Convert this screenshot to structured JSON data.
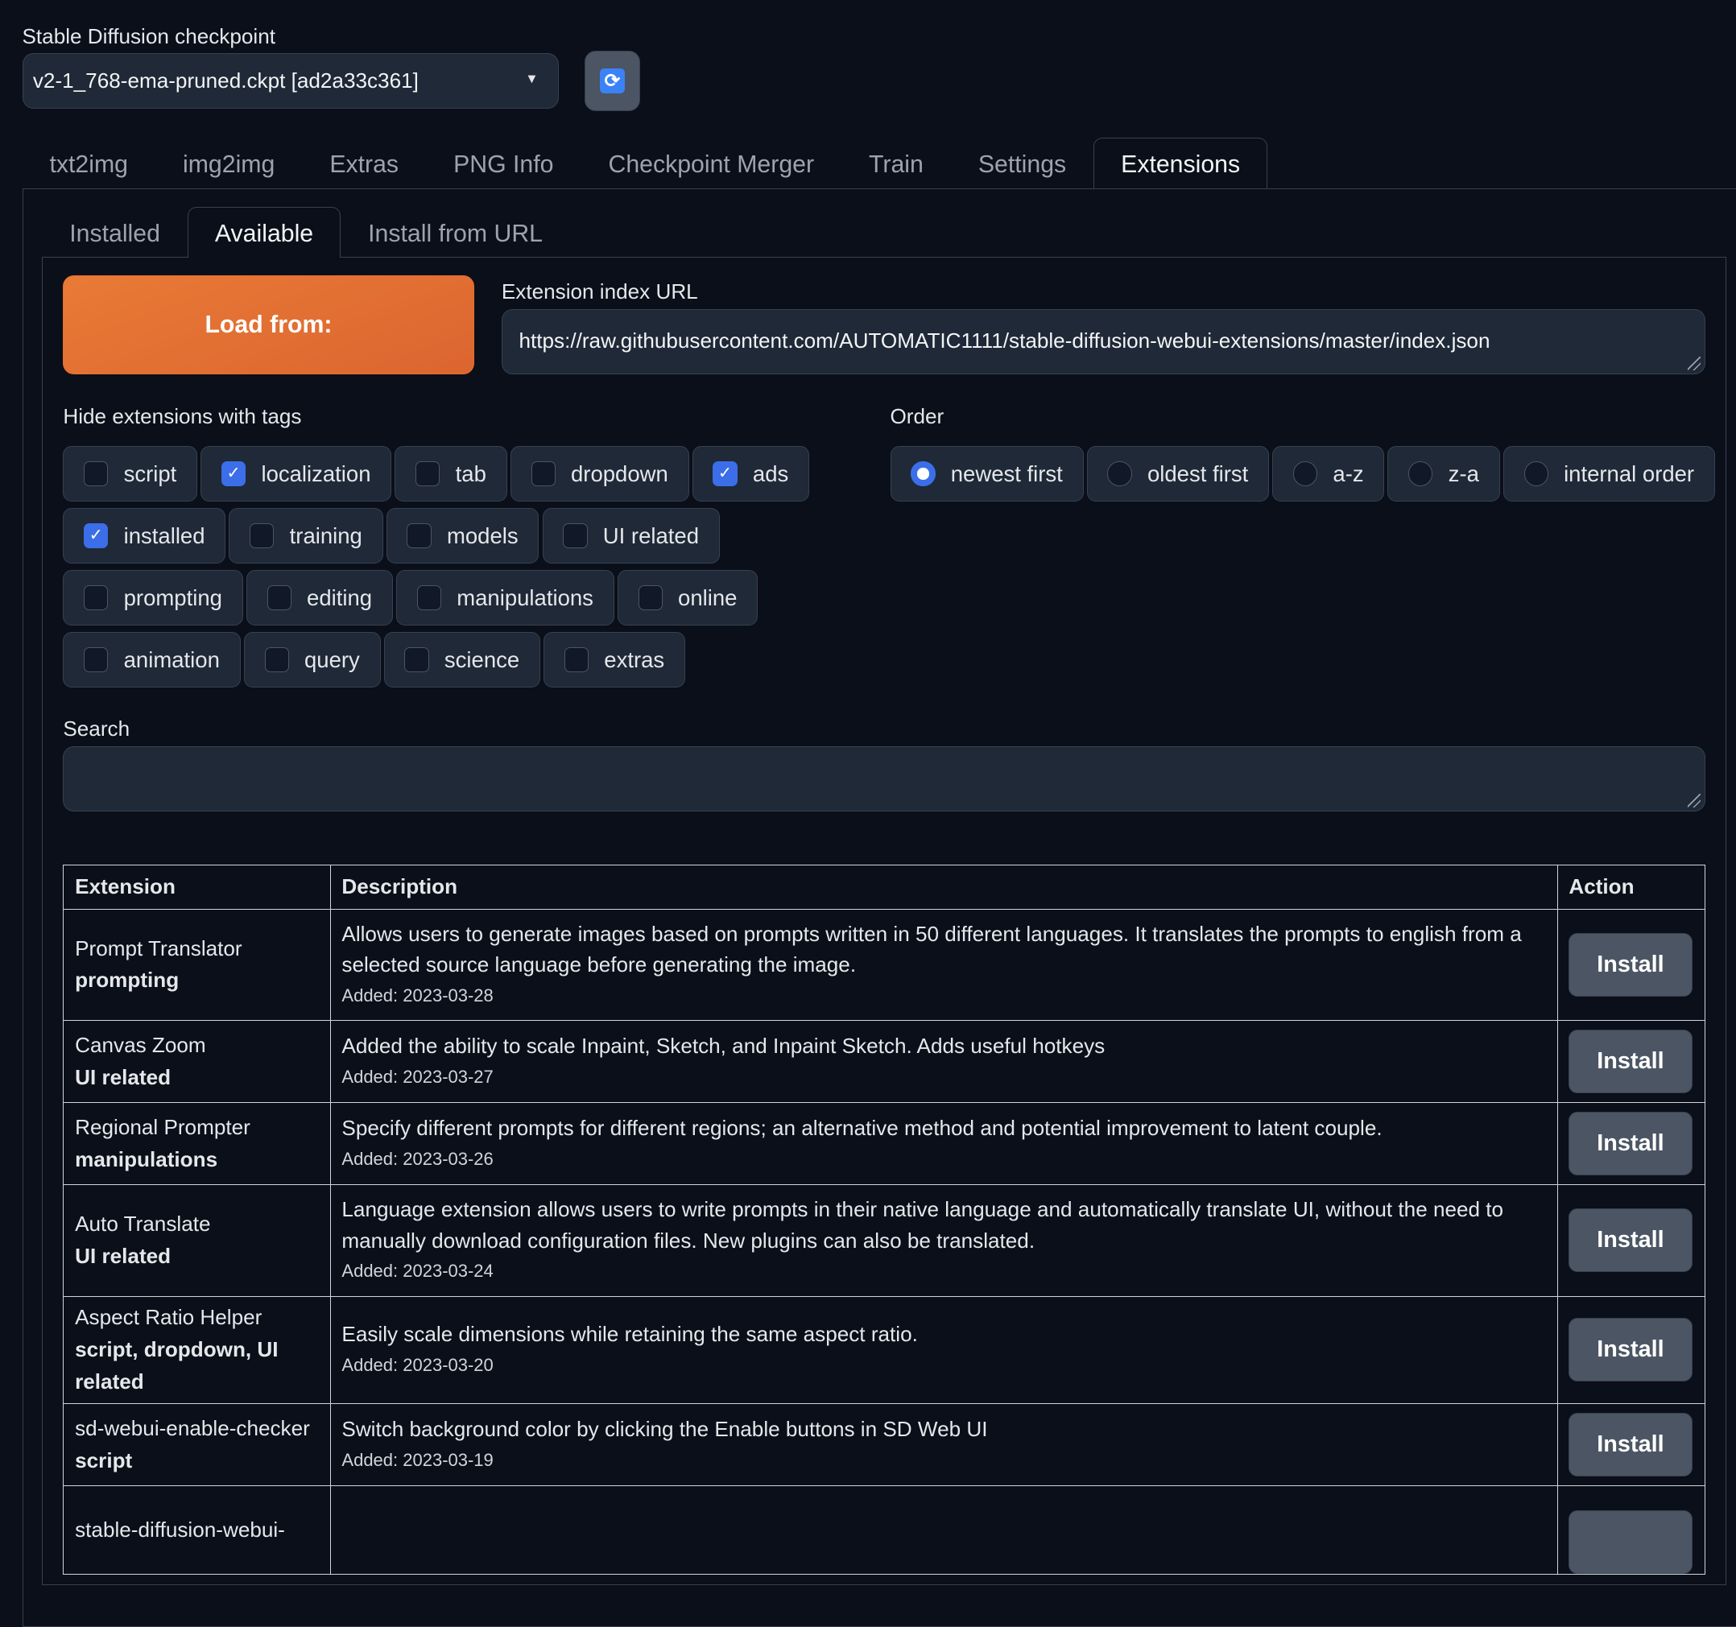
{
  "checkpoint": {
    "label": "Stable Diffusion checkpoint",
    "value": "v2-1_768-ema-pruned.ckpt [ad2a33c361]",
    "refresh_icon": "refresh-icon"
  },
  "main_tabs": [
    {
      "label": "txt2img"
    },
    {
      "label": "img2img"
    },
    {
      "label": "Extras"
    },
    {
      "label": "PNG Info"
    },
    {
      "label": "Checkpoint Merger"
    },
    {
      "label": "Train"
    },
    {
      "label": "Settings"
    },
    {
      "label": "Extensions",
      "active": true
    }
  ],
  "sub_tabs": [
    {
      "label": "Installed"
    },
    {
      "label": "Available",
      "active": true
    },
    {
      "label": "Install from URL"
    }
  ],
  "load_button": "Load from:",
  "index_url": {
    "label": "Extension index URL",
    "value": "https://raw.githubusercontent.com/AUTOMATIC1111/stable-diffusion-webui-extensions/master/index.json"
  },
  "hide_tags": {
    "label": "Hide extensions with tags",
    "rows": [
      [
        {
          "label": "script",
          "checked": false
        },
        {
          "label": "localization",
          "checked": true
        },
        {
          "label": "tab",
          "checked": false
        },
        {
          "label": "dropdown",
          "checked": false
        },
        {
          "label": "ads",
          "checked": true
        }
      ],
      [
        {
          "label": "installed",
          "checked": true
        },
        {
          "label": "training",
          "checked": false
        },
        {
          "label": "models",
          "checked": false
        },
        {
          "label": "UI related",
          "checked": false
        }
      ],
      [
        {
          "label": "prompting",
          "checked": false
        },
        {
          "label": "editing",
          "checked": false
        },
        {
          "label": "manipulations",
          "checked": false
        },
        {
          "label": "online",
          "checked": false
        }
      ],
      [
        {
          "label": "animation",
          "checked": false
        },
        {
          "label": "query",
          "checked": false
        },
        {
          "label": "science",
          "checked": false
        },
        {
          "label": "extras",
          "checked": false
        }
      ]
    ]
  },
  "order": {
    "label": "Order",
    "options": [
      {
        "label": "newest first",
        "selected": true
      },
      {
        "label": "oldest first"
      },
      {
        "label": "a-z"
      },
      {
        "label": "z-a"
      },
      {
        "label": "internal order"
      }
    ]
  },
  "search": {
    "label": "Search",
    "value": ""
  },
  "table": {
    "headers": [
      "Extension",
      "Description",
      "Action"
    ],
    "rows": [
      {
        "name": "Prompt Translator",
        "tags": "prompting",
        "description": "Allows users to generate images based on prompts written in 50 different languages. It translates the prompts to english from a selected source language before generating the image.",
        "added": "Added: 2023-03-28",
        "action": "Install"
      },
      {
        "name": "Canvas Zoom",
        "tags": "UI related",
        "description": "Added the ability to scale Inpaint, Sketch, and Inpaint Sketch. Adds useful hotkeys",
        "added": "Added: 2023-03-27",
        "action": "Install"
      },
      {
        "name": "Regional Prompter",
        "tags": "manipulations",
        "description": "Specify different prompts for different regions; an alternative method and potential improvement to latent couple.",
        "added": "Added: 2023-03-26",
        "action": "Install"
      },
      {
        "name": "Auto Translate",
        "tags": "UI related",
        "description": "Language extension allows users to write prompts in their native language and automatically translate UI, without the need to manually download configuration files. New plugins can also be translated.",
        "added": "Added: 2023-03-24",
        "action": "Install"
      },
      {
        "name": "Aspect Ratio Helper",
        "tags": "script, dropdown, UI related",
        "description": "Easily scale dimensions while retaining the same aspect ratio.",
        "added": "Added: 2023-03-20",
        "action": "Install"
      },
      {
        "name": "sd-webui-enable-checker",
        "tags": "script",
        "description": "Switch background color by clicking the Enable buttons in SD Web UI",
        "added": "Added: 2023-03-19",
        "action": "Install"
      },
      {
        "name": "stable-diffusion-webui-",
        "tags": "",
        "description": "",
        "added": "",
        "action": ""
      }
    ]
  },
  "colors": {
    "accent": "#3b6ee8",
    "load_button": "#e4702f",
    "background": "#0b0f19"
  }
}
